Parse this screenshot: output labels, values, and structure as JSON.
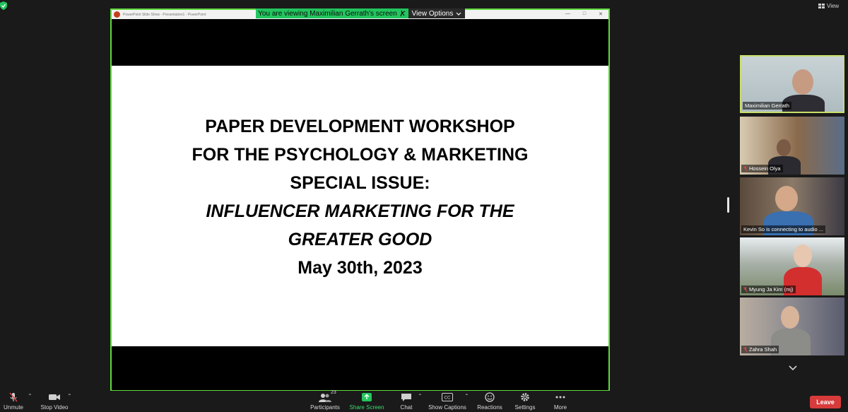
{
  "top_bar": {
    "view_label": "View"
  },
  "banner": {
    "viewing_text": "You are viewing Maximilian Gerrath's screen",
    "view_options_label": "View Options"
  },
  "ppt": {
    "window_title": "PowerPoint Slide Show - Presentation1 - PowerPoint"
  },
  "slide": {
    "line1": "PAPER DEVELOPMENT WORKSHOP",
    "line2": "FOR THE PSYCHOLOGY & MARKETING",
    "line3": "SPECIAL ISSUE:",
    "line4": "INFLUENCER MARKETING FOR THE",
    "line5": "GREATER GOOD",
    "line6": "May 30th, 2023"
  },
  "participants": [
    {
      "name": "Maximilian Gerrath",
      "muted": false,
      "active_speaker": true
    },
    {
      "name": "Hossein Olya",
      "muted": true
    },
    {
      "name": "Kevin So is connecting to audio ...",
      "muted": false
    },
    {
      "name": "Myung Ja Kim (mj)",
      "muted": true
    },
    {
      "name": "Zahra Shah",
      "muted": true
    }
  ],
  "toolbar": {
    "unmute": "Unmute",
    "stop_video": "Stop Video",
    "participants": "Participants",
    "participants_count": "23",
    "share_screen": "Share Screen",
    "chat": "Chat",
    "show_captions": "Show Captions",
    "reactions": "Reactions",
    "settings": "Settings",
    "more": "More",
    "leave": "Leave"
  },
  "colors": {
    "share_border": "#5fd93b",
    "banner": "#22c55e",
    "leave": "#d83b3b",
    "active_tile": "#c8e06a"
  }
}
